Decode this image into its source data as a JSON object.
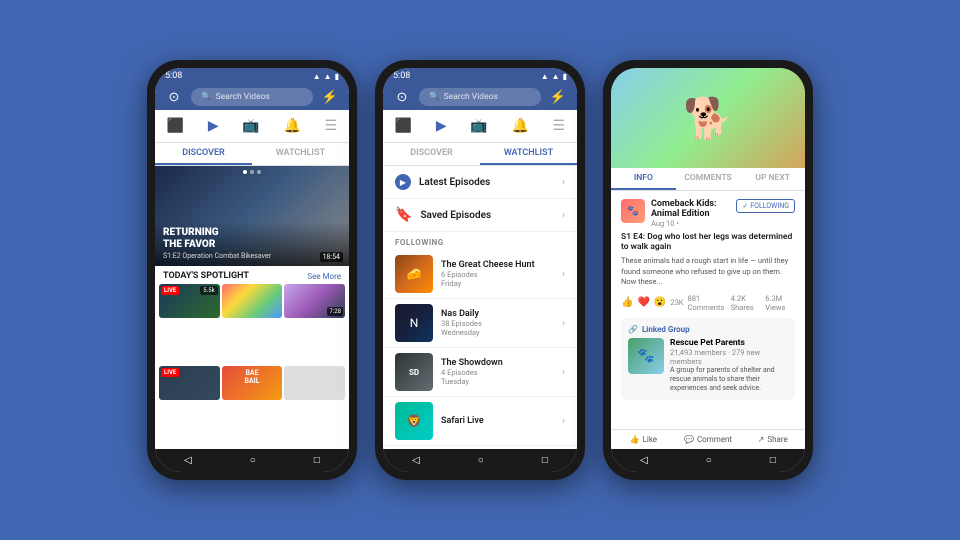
{
  "background_color": "#4267B2",
  "phone1": {
    "status_bar": {
      "time": "5:08",
      "icons": [
        "signal",
        "wifi",
        "battery"
      ]
    },
    "search_placeholder": "Search Videos",
    "nav_icons": [
      "camera",
      "play",
      "tv",
      "bell",
      "list"
    ],
    "tabs": [
      {
        "label": "DISCOVER",
        "active": true
      },
      {
        "label": "WATCHLIST",
        "active": false
      }
    ],
    "hero": {
      "title": "RETURNING\nTHE FAVOR",
      "subtitle": "S1:E2 Operation Combat Bikesaver",
      "duration": "18:54"
    },
    "spotlight": {
      "label": "TODAY'S SPOTLIGHT",
      "see_more": "See More"
    },
    "videos": [
      {
        "type": "live",
        "viewers": "5.5k",
        "bg": "baseball"
      },
      {
        "type": "normal",
        "bg": "colorful"
      },
      {
        "type": "normal",
        "bg": "woman",
        "duration": "7:28"
      },
      {
        "type": "live",
        "label": "LIVE",
        "bg": "live-thumb"
      },
      {
        "type": "normal",
        "label": "BAE\nBAIL",
        "bg": "bae"
      }
    ]
  },
  "phone2": {
    "status_bar": {
      "time": "5:08"
    },
    "search_placeholder": "Search Videos",
    "tabs": [
      {
        "label": "DISCOVER",
        "active": false
      },
      {
        "label": "WATCHLIST",
        "active": true
      }
    ],
    "sections": [
      {
        "label": "Latest Episodes",
        "type": "play"
      },
      {
        "label": "Saved Episodes",
        "type": "bookmark"
      }
    ],
    "following_label": "FOLLOWING",
    "shows": [
      {
        "name": "The Great Cheese Hunt",
        "episodes": "6 Episodes",
        "day": "Friday",
        "bg": "cheese"
      },
      {
        "name": "Nas Daily",
        "episodes": "38 Episodes",
        "day": "Wednesday",
        "bg": "nas"
      },
      {
        "name": "The Showdown",
        "episodes": "4 Episodes",
        "day": "Tuesday",
        "bg": "showdown"
      },
      {
        "name": "Safari Live",
        "episodes": "",
        "day": "",
        "bg": "safari"
      }
    ]
  },
  "phone3": {
    "status_bar": {
      "time": "5:08"
    },
    "info_tabs": [
      {
        "label": "INFO",
        "active": true
      },
      {
        "label": "COMMENTS",
        "active": false
      },
      {
        "label": "UP NEXT",
        "active": false
      }
    ],
    "show": {
      "name": "Comeback Kids: Animal Edition",
      "date": "Aug 10 •",
      "following": "FOLLOWING",
      "episode_title": "S1 E4: Dog who lost her legs was determined to walk again",
      "description": "These animals had a rough start in life — until they found someone who refused to give up on them. Now these...",
      "reactions": "23K",
      "comments": "881 Comments",
      "shares": "4.2K Shares",
      "views": "6.3M Views"
    },
    "linked_group": {
      "label": "Linked Group",
      "name": "Rescue Pet Parents",
      "members": "21,493 members · 279 new members",
      "description": "A group for parents of shelter and rescue animals to share their experiences and seek advice."
    },
    "actions": [
      {
        "label": "Like",
        "icon": "👍"
      },
      {
        "label": "Comment",
        "icon": "💬"
      },
      {
        "label": "Share",
        "icon": "↗"
      }
    ]
  }
}
